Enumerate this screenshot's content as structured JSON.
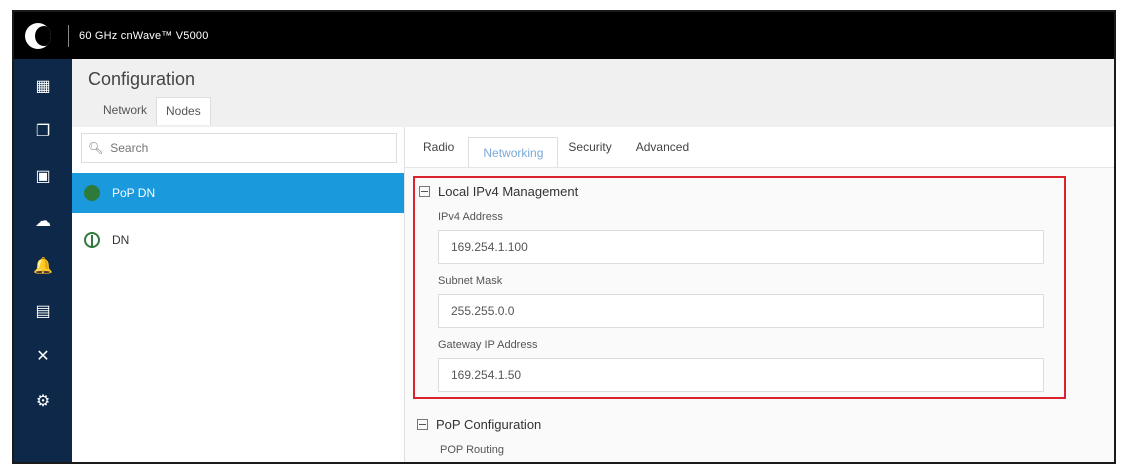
{
  "app": {
    "title": "60 GHz cnWave™ V5000"
  },
  "sidenav": {
    "items": [
      {
        "name": "dashboard-icon",
        "glyph": "▦"
      },
      {
        "name": "copy-icon",
        "glyph": "❐"
      },
      {
        "name": "document-icon",
        "glyph": "▣"
      },
      {
        "name": "cloud-icon",
        "glyph": "☁"
      },
      {
        "name": "bell-icon",
        "glyph": "🔔"
      },
      {
        "name": "calendar-icon",
        "glyph": "▤"
      },
      {
        "name": "tools-icon",
        "glyph": "✕"
      },
      {
        "name": "settings-icon",
        "glyph": "⚙"
      }
    ]
  },
  "page": {
    "title": "Configuration",
    "tabs": [
      {
        "label": "Network"
      },
      {
        "label": "Nodes"
      }
    ]
  },
  "left": {
    "search_placeholder": "Search",
    "nodes": [
      {
        "label": "PoP DN"
      },
      {
        "label": "DN"
      }
    ]
  },
  "right": {
    "tabs": [
      {
        "label": "Radio"
      },
      {
        "label": "Networking"
      },
      {
        "label": "Security"
      },
      {
        "label": "Advanced"
      }
    ],
    "section_title": "Local IPv4 Management",
    "fields": [
      {
        "label": "IPv4 Address",
        "value": "169.254.1.100"
      },
      {
        "label": "Subnet Mask",
        "value": "255.255.0.0"
      },
      {
        "label": "Gateway IP Address",
        "value": "169.254.1.50"
      }
    ],
    "pop_section_title": "PoP Configuration",
    "pop_routing_label": "POP Routing"
  },
  "colors": {
    "accent": "#1a99dd",
    "sidenav": "#0d2848",
    "highlight_border": "#d9232d"
  }
}
